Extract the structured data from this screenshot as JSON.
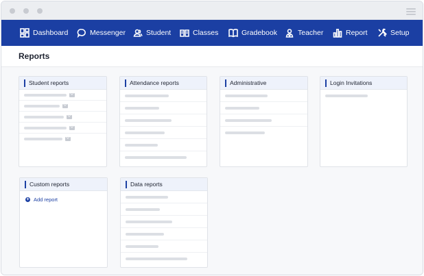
{
  "nav": [
    {
      "label": "Dashboard",
      "icon": "dashboard-icon"
    },
    {
      "label": "Messenger",
      "icon": "chat-bubble-icon"
    },
    {
      "label": "Student",
      "icon": "users-icon"
    },
    {
      "label": "Classes",
      "icon": "book-open-icon"
    },
    {
      "label": "Gradebook",
      "icon": "gradebook-icon"
    },
    {
      "label": "Teacher",
      "icon": "teacher-icon"
    },
    {
      "label": "Report",
      "icon": "bar-chart-icon"
    },
    {
      "label": "Setup",
      "icon": "tools-icon"
    }
  ],
  "page": {
    "title": "Reports"
  },
  "cards": {
    "student_reports": {
      "title": "Student reports"
    },
    "attendance_reports": {
      "title": "Attendance reports"
    },
    "administrative": {
      "title": "Administrative"
    },
    "login_invitations": {
      "title": "Login Invitations"
    },
    "custom_reports": {
      "title": "Custom reports",
      "add_label": "Add report"
    },
    "data_reports": {
      "title": "Data reports"
    }
  },
  "colors": {
    "brand": "#1b3fa3",
    "header_bg": "#eef2fb",
    "placeholder": "#dcdfe4"
  }
}
